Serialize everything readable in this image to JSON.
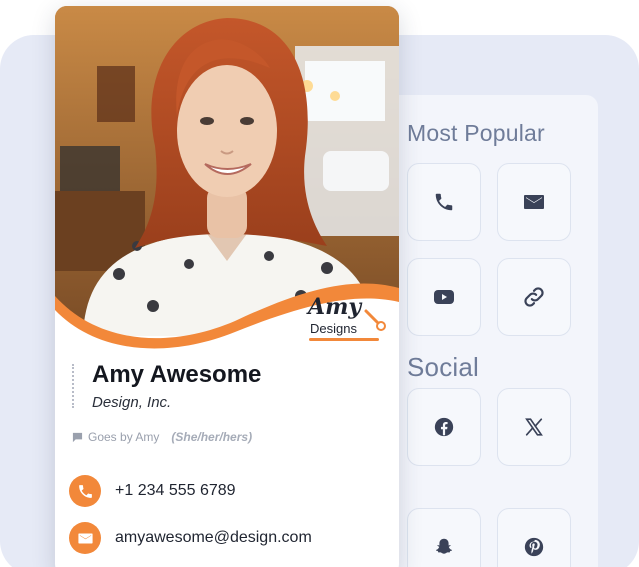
{
  "card": {
    "logo": {
      "line1": "Amy",
      "line2": "Designs"
    },
    "name": "Amy Awesome",
    "company": "Design, Inc.",
    "goes_by": "Goes by Amy",
    "pronouns": "(She/her/hers)",
    "phone": "+1 234 555 6789",
    "email": "amyawesome@design.com"
  },
  "panel": {
    "popular_title": "Most Popular",
    "social_title": "Social",
    "popular_icons": [
      "phone-icon",
      "email-icon",
      "youtube-icon",
      "link-icon"
    ],
    "social_icons": [
      "facebook-icon",
      "x-icon",
      "snapchat-icon",
      "pinterest-icon"
    ]
  },
  "colors": {
    "accent": "#f2883a",
    "background": "#e6eaf6",
    "panel": "#f3f5fb",
    "tile_border": "#dde3ef",
    "icon": "#3a4258",
    "title": "#6f7c99"
  }
}
